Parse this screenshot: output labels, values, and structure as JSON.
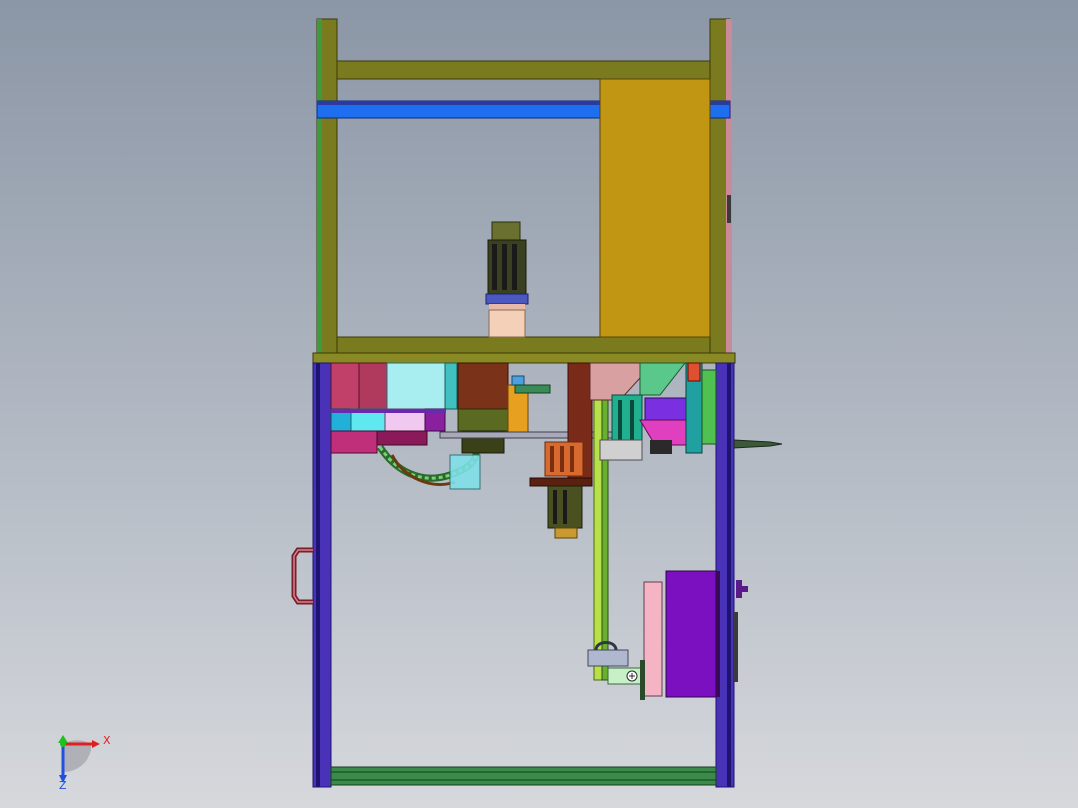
{
  "axis_triad": {
    "x_label": "X",
    "z_label": "Z"
  },
  "colors": {
    "background_top": "#8b96a6",
    "background_bottom": "#d6d8dc",
    "upper_frame": "#7a7a1e",
    "upper_frame_dark": "#4f4f10",
    "blue_beam": "#1e6ef0",
    "gold_panel": "#c09612",
    "lower_frame": "#4a32b8",
    "lower_frame_dark": "#1c1470",
    "motor_dark": "#505a28",
    "axis_x": "#e02020",
    "axis_y": "#20c020",
    "axis_z": "#2050e0"
  }
}
